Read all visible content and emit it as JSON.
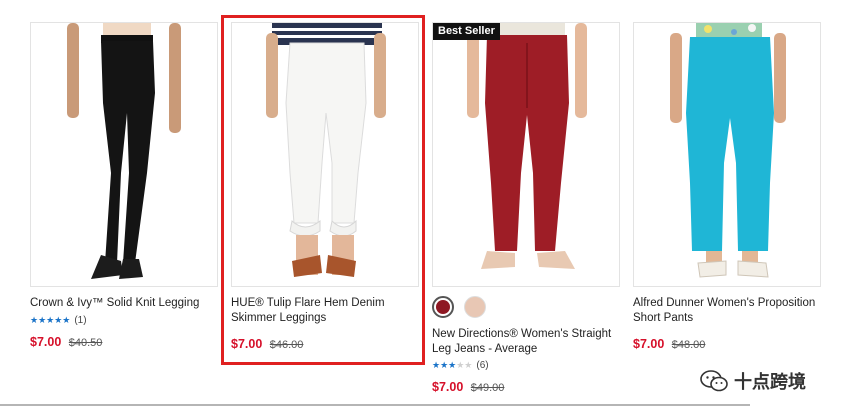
{
  "products": [
    {
      "title": "Crown & Ivy™ Solid Knit Legging",
      "stars": "★★★★★",
      "stars_off": "",
      "review_count": "(1)",
      "sale_price": "$7.00",
      "original_price": "$40.50",
      "image_icon": "product-photo-black-legging"
    },
    {
      "title": "HUE® Tulip Flare Hem Denim Skimmer Leggings",
      "sale_price": "$7.00",
      "original_price": "$46.00",
      "image_icon": "product-photo-white-denim"
    },
    {
      "badge": "Best Seller",
      "swatch_colors": [
        "#8e1823",
        "#e8c7b4"
      ],
      "title": "New Directions® Women's Straight Leg Jeans - Average",
      "stars": "★★★",
      "stars_off": "★★",
      "review_count": "(6)",
      "sale_price": "$7.00",
      "original_price": "$49.00",
      "image_icon": "product-photo-red-jeans"
    },
    {
      "title": "Alfred Dunner Women's Proposition Short Pants",
      "sale_price": "$7.00",
      "original_price": "$48.00",
      "image_icon": "product-photo-turquoise-pants"
    }
  ],
  "watermark": {
    "text": "十点跨境",
    "icon": "wechat-icon"
  },
  "colors": {
    "sale": "#d6102a",
    "highlight": "#e02020",
    "stars": "#1a73c8"
  }
}
